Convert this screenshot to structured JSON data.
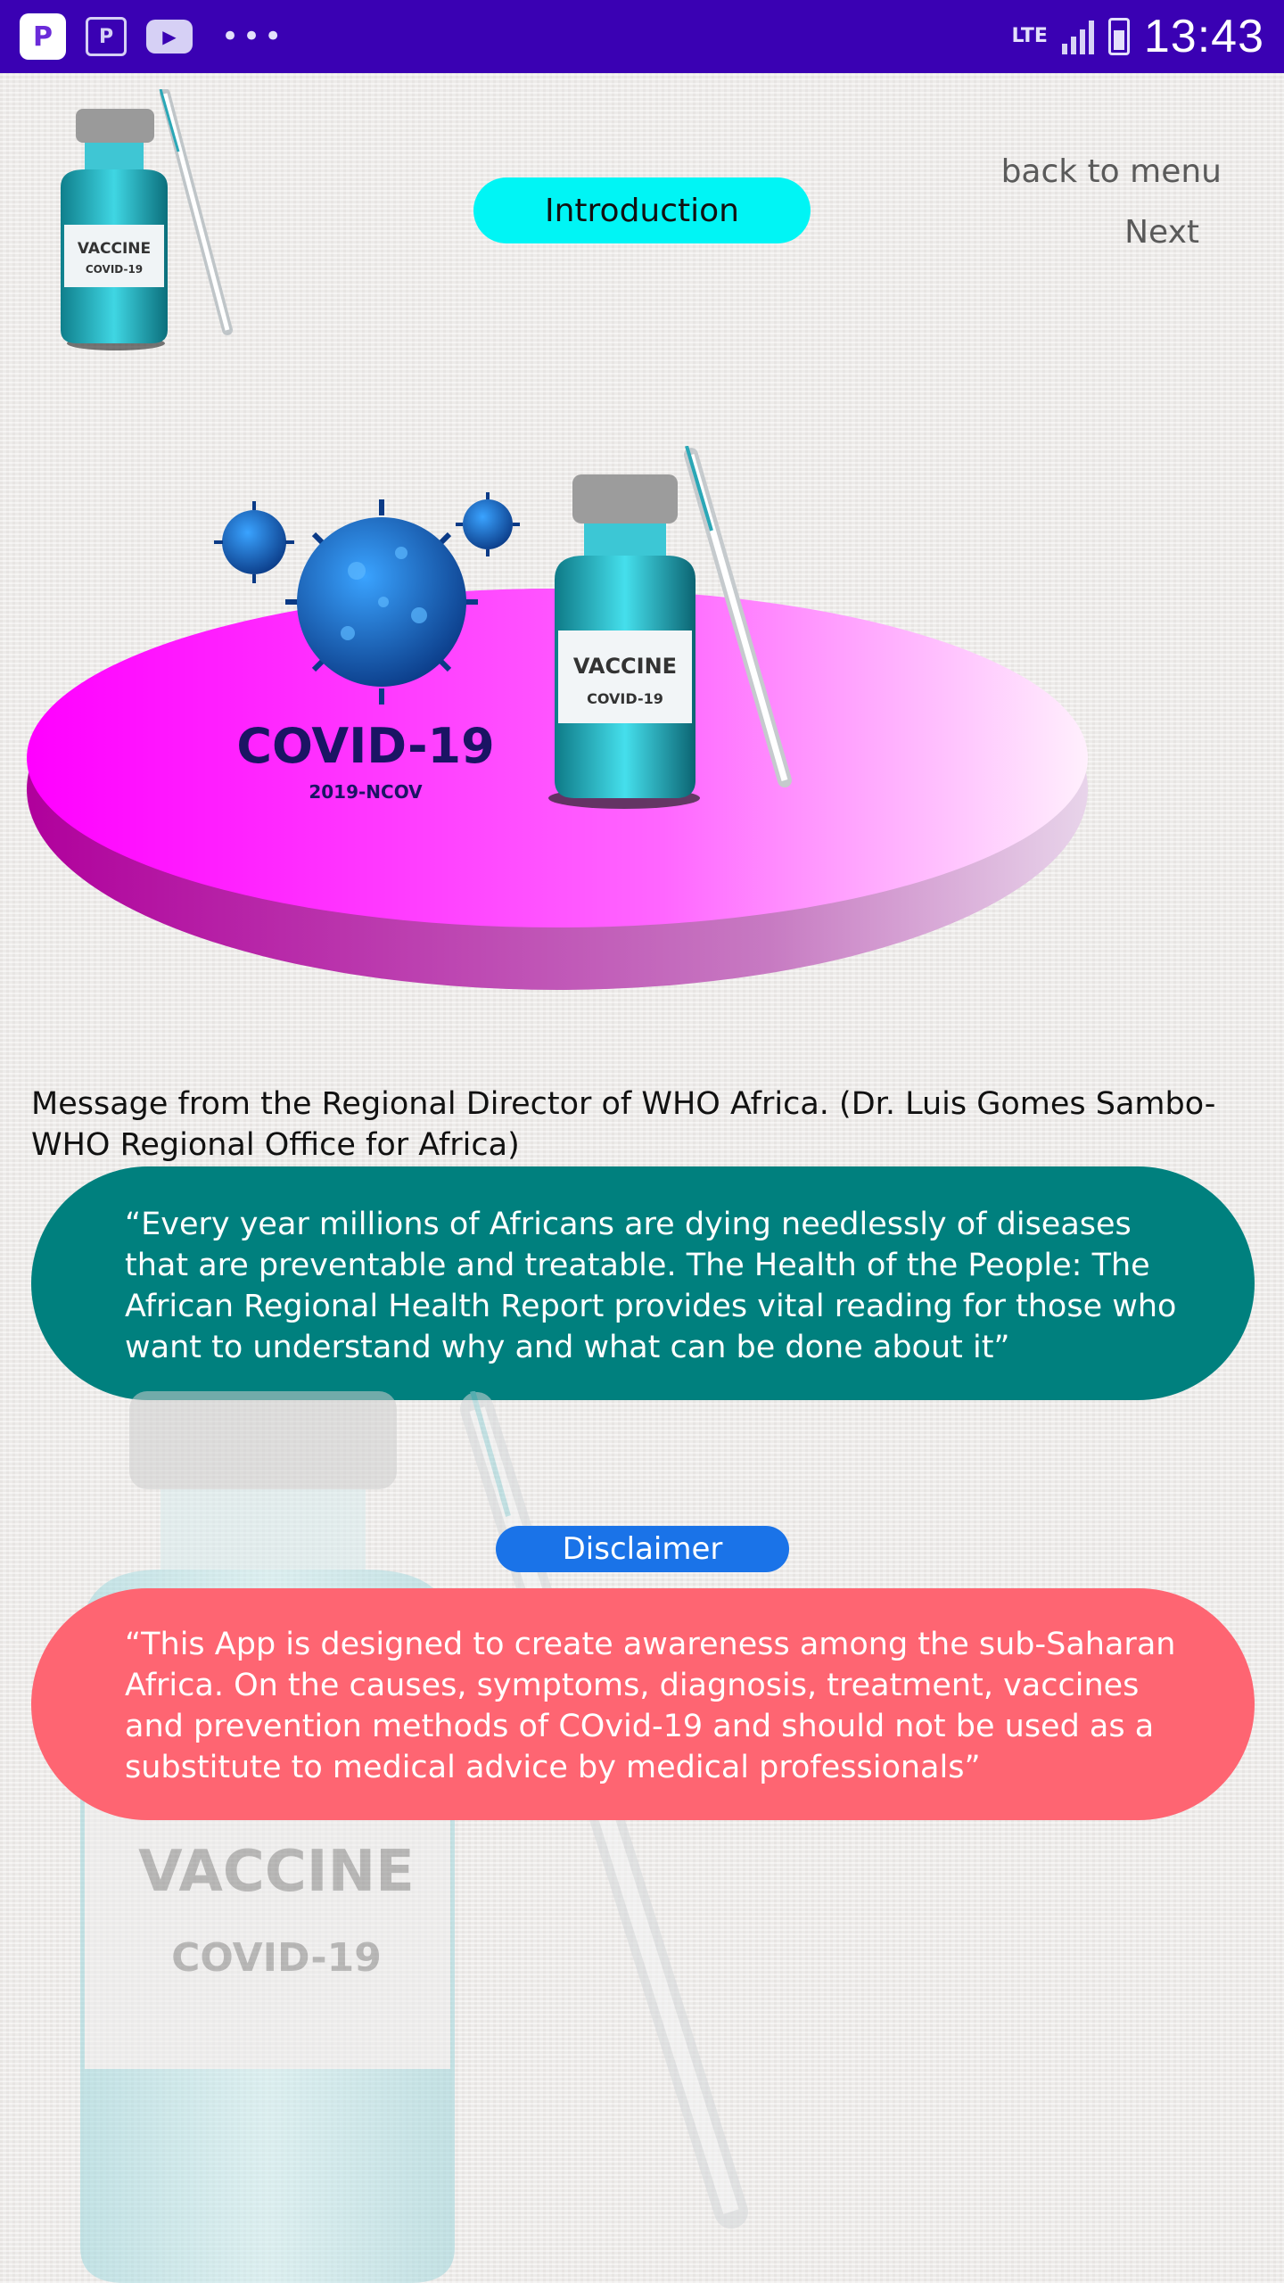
{
  "status_bar": {
    "network": "LTE",
    "time": "13:43"
  },
  "header": {
    "title_button": "Introduction",
    "back_link": "back to menu",
    "next_link": "Next"
  },
  "hero": {
    "covid_label": "COVID-19",
    "covid_sub": "2019-NCOV",
    "vial_label": "VACCINE",
    "vial_sub": "COVID-19"
  },
  "message": {
    "heading": "Message from the Regional Director of WHO Africa. (Dr. Luis Gomes Sambo- WHO Regional Office for Africa)",
    "quote": "“Every year millions of Africans are dying needlessly of diseases that are preventable and treatable. The Health of the People: The African Regional Health Report provides vital reading for those who want to understand why and what can be done about it”"
  },
  "disclaimer": {
    "button": "Disclaimer",
    "text": "“This App is designed to create awareness among the sub-Saharan Africa. On the causes, symptoms, diagnosis, treatment, vaccines and prevention methods of COvid-19 and should not be used as a substitute to medical advice by medical professionals”"
  },
  "colors": {
    "status_bar": "#3a01b3",
    "intro_button": "#00f5f5",
    "quote_box": "#00807e",
    "disclaimer_button": "#1a73e8",
    "disclaimer_box": "#fe6572",
    "platform": "#ff00ff"
  }
}
